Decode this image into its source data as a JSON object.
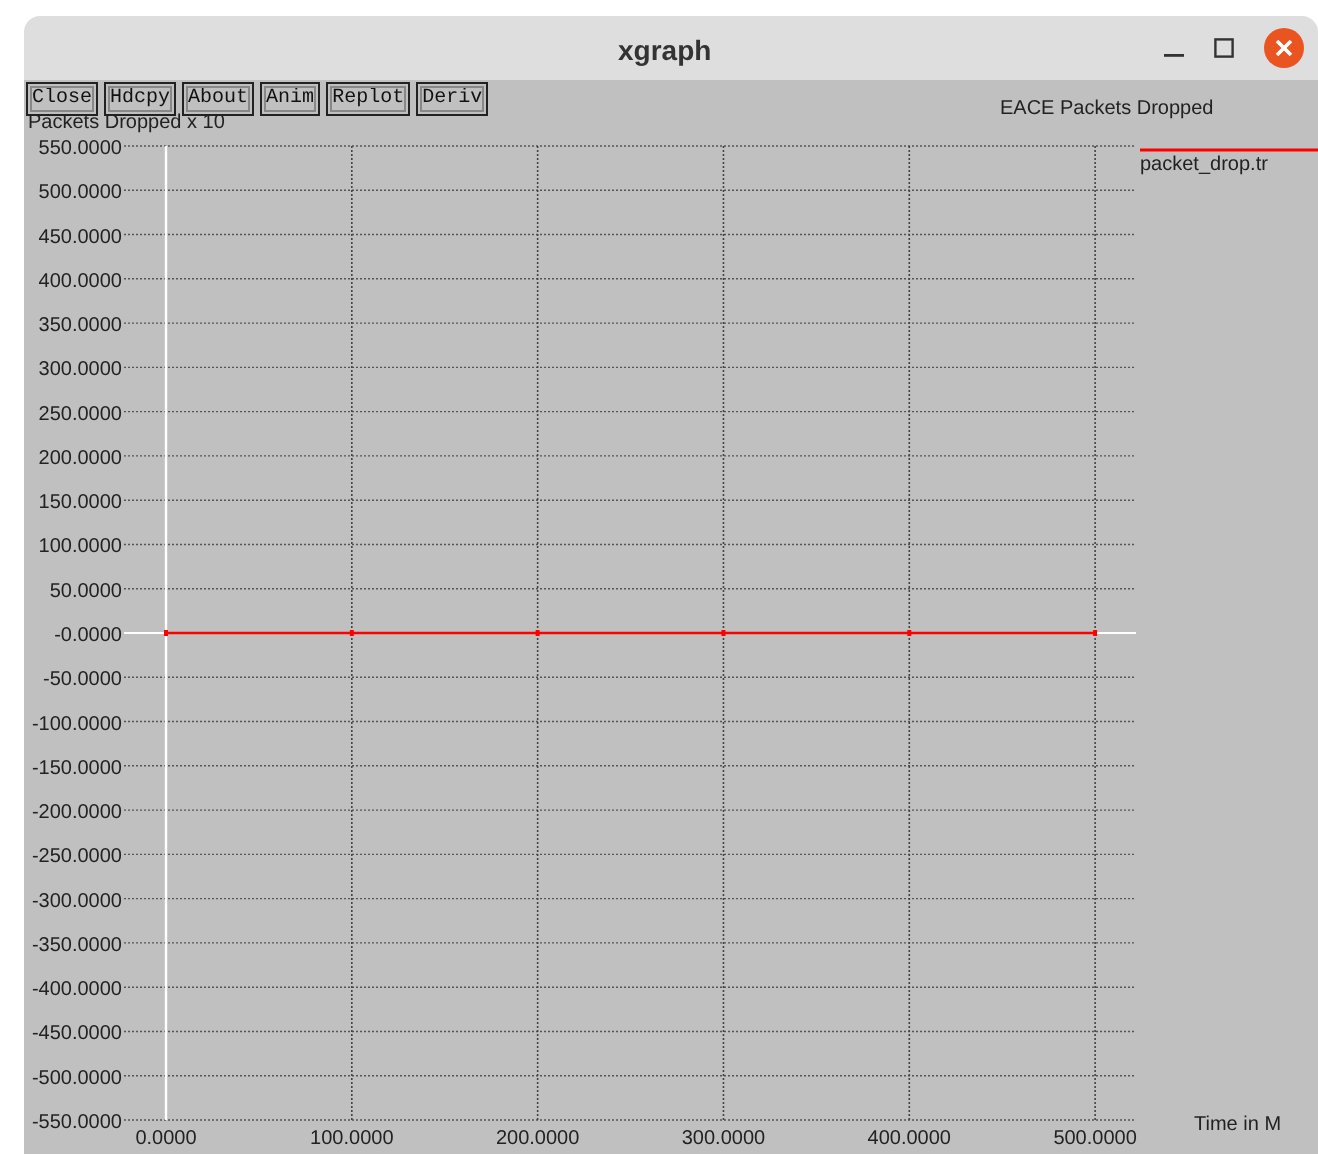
{
  "window": {
    "title": "xgraph"
  },
  "toolbar": {
    "buttons": [
      "Close",
      "Hdcpy",
      "About",
      "Anim",
      "Replot",
      "Deriv"
    ]
  },
  "chart": {
    "chart_data": {
      "type": "line",
      "grid": true,
      "title": "EACE Packets Dropped",
      "xlabel": "Time in M",
      "ylabel": "Packets Dropped x 10",
      "x": [
        0,
        100,
        200,
        300,
        400,
        500
      ],
      "series": [
        {
          "name": "packet_drop.tr",
          "color": "#ff0000",
          "marker": "square",
          "values": [
            0,
            0,
            0,
            0,
            0,
            0
          ]
        }
      ],
      "xlim": [
        -22.6,
        522
      ],
      "ylim": [
        -550,
        550
      ],
      "xticks": [
        {
          "value": 0,
          "label": "0.0000"
        },
        {
          "value": 100,
          "label": "100.0000"
        },
        {
          "value": 200,
          "label": "200.0000"
        },
        {
          "value": 300,
          "label": "300.0000"
        },
        {
          "value": 400,
          "label": "400.0000"
        },
        {
          "value": 500,
          "label": "500.0000"
        }
      ],
      "yticks": [
        {
          "value": 550,
          "label": "550.0000"
        },
        {
          "value": 500,
          "label": "500.0000"
        },
        {
          "value": 450,
          "label": "450.0000"
        },
        {
          "value": 400,
          "label": "400.0000"
        },
        {
          "value": 350,
          "label": "350.0000"
        },
        {
          "value": 300,
          "label": "300.0000"
        },
        {
          "value": 250,
          "label": "250.0000"
        },
        {
          "value": 200,
          "label": "200.0000"
        },
        {
          "value": 150,
          "label": "150.0000"
        },
        {
          "value": 100,
          "label": "100.0000"
        },
        {
          "value": 50,
          "label": "50.0000"
        },
        {
          "value": 0,
          "label": "-0.0000"
        },
        {
          "value": -50,
          "label": "-50.0000"
        },
        {
          "value": -100,
          "label": "-100.0000"
        },
        {
          "value": -150,
          "label": "-150.0000"
        },
        {
          "value": -200,
          "label": "-200.0000"
        },
        {
          "value": -250,
          "label": "-250.0000"
        },
        {
          "value": -300,
          "label": "-300.0000"
        },
        {
          "value": -350,
          "label": "-350.0000"
        },
        {
          "value": -400,
          "label": "-400.0000"
        },
        {
          "value": -450,
          "label": "-450.0000"
        },
        {
          "value": -500,
          "label": "-500.0000"
        },
        {
          "value": -550,
          "label": "-550.0000"
        }
      ]
    }
  }
}
